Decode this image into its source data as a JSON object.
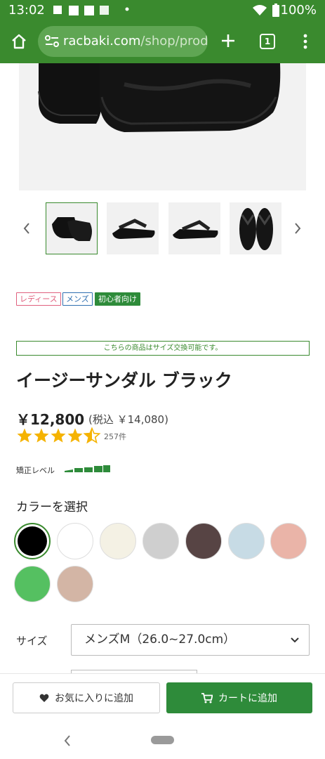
{
  "status_bar": {
    "time": "13:02",
    "battery": "100%"
  },
  "browser": {
    "url_host": "racbaki.com",
    "url_path": "/shop/prodi",
    "tab_count": "1"
  },
  "tags": [
    {
      "label": "レディース",
      "color": "#e0607e"
    },
    {
      "label": "メンズ",
      "color": "#2f6fb0"
    },
    {
      "label": "初心者向け",
      "color": "#2e8b3a"
    }
  ],
  "notice": "こちらの商品はサイズ交換可能です。",
  "product": {
    "title": "イージーサンダル ブラック",
    "price": "￥12,800",
    "tax_price": "(税込 ￥14,080)",
    "rating": 4.5,
    "review_count": "257件"
  },
  "level": {
    "label": "矯正レベル",
    "value": 5,
    "max": 5
  },
  "color_section": {
    "heading": "カラーを選択",
    "swatches": [
      {
        "name": "black",
        "hex": "#000000"
      },
      {
        "name": "white",
        "hex": "#ffffff"
      },
      {
        "name": "ivory",
        "hex": "#f4f1e4"
      },
      {
        "name": "light-gray",
        "hex": "#cfcfcf"
      },
      {
        "name": "dark-brown",
        "hex": "#574444"
      },
      {
        "name": "light-blue",
        "hex": "#c7dbe5"
      },
      {
        "name": "pink",
        "hex": "#eab4a8"
      },
      {
        "name": "green",
        "hex": "#55c061"
      },
      {
        "name": "beige",
        "hex": "#d3b5a5"
      }
    ],
    "selected_index": 0
  },
  "size": {
    "label": "サイズ",
    "value": "メンズM（26.0~27.0cm）"
  },
  "actions": {
    "favorite_label": "お気に入りに追加",
    "cart_label": "カートに追加"
  },
  "colors": {
    "brand_green": "#3a8a2e",
    "button_green": "#2e8b3a",
    "star": "#f5b301"
  },
  "icons": [
    "home-icon",
    "site-settings-icon",
    "plus-icon",
    "tabs-icon",
    "more-icon",
    "chevron-left-icon",
    "chevron-right-icon",
    "star-icon",
    "heart-icon",
    "cart-icon",
    "chevron-down-icon",
    "back-icon",
    "home-pill-icon"
  ]
}
